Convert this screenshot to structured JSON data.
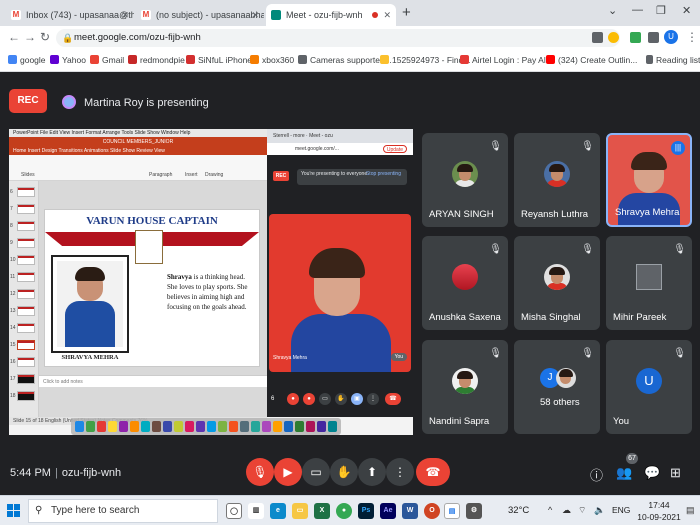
{
  "browser": {
    "tabs": [
      {
        "label": "Inbox (743) - upasanaa@theinde",
        "favicon": "gmail-icon"
      },
      {
        "label": "(no subject) - upasanaabhalla13@",
        "favicon": "gmail-icon"
      },
      {
        "label": "Meet - ozu-fijb-wnh",
        "favicon": "meet-icon"
      }
    ],
    "new_tab": "+",
    "url": "meet.google.com/ozu-fijb-wnh",
    "profile_initial": "U",
    "bookmarks": [
      "google",
      "Yahoo",
      "Gmail",
      "redmondpie",
      "SiNfuL iPhone",
      "xbox360",
      "Cameras supported...",
      "1525924973 - Find...",
      "Airtel Login : Pay Al...",
      "(324) Create Outlin..."
    ],
    "reading_list": "Reading list"
  },
  "meet": {
    "rec_label": "REC",
    "presenting_text": "Martina Roy is presenting",
    "meeting_time": "5:44 PM",
    "meeting_code": "ozu-fijb-wnh",
    "people_count": "67",
    "participants": [
      {
        "name": "ARYAN SINGH",
        "muted": true
      },
      {
        "name": "Reyansh Luthra",
        "muted": true
      },
      {
        "name": "Shravya Mehra",
        "muted": false,
        "speaking": true
      },
      {
        "name": "Anushka Saxena",
        "muted": true
      },
      {
        "name": "Misha Singhal",
        "muted": true
      },
      {
        "name": "Mihir Pareek",
        "muted": true
      },
      {
        "name": "Nandini Sapra",
        "muted": true
      },
      {
        "name": "58 others",
        "muted": true,
        "avatar_initial": "J"
      },
      {
        "name": "You",
        "muted": true,
        "avatar_initial": "U"
      }
    ]
  },
  "shared_screen": {
    "menubar": "PowerPoint  File  Edit  View  Insert  Format  Arrange  Tools  Slide Show  Window  Help",
    "doc_title": "COUNCIL MEMBERS_JUNIOR",
    "ribbon_tabs": "Home  Insert  Design  Transitions  Animations  Slide Show  Review  View",
    "toolbar_labels": [
      "Slides",
      "Paragraph",
      "Insert",
      "Drawing"
    ],
    "thumb_numbers": [
      "6",
      "7",
      "8",
      "9",
      "10",
      "11",
      "12",
      "13",
      "14",
      "15",
      "16",
      "17",
      "18"
    ],
    "slide": {
      "title_first": "VARUN",
      "title_rest": " HOUSE CAPTAIN",
      "crest_label": "",
      "photo_caption": "SHRAVYA MEHRA",
      "bio_name": "Shravya",
      "bio_text": " is a thinking head. She loves to play sports. She believes in aiming high and focusing on the goals ahead."
    },
    "notes_placeholder": "Click to add notes",
    "status_text": "Slide 15 of 18   English (United States)   Notes   Comments   76%",
    "sub_meet": {
      "tabs_text": "Sterrell - more  ·  Meet - ozu",
      "url": "meet.google.com/...",
      "update_label": "Update",
      "rec_label": "REC",
      "notice": "You're presenting to everyone",
      "stop_label": "Stop presenting",
      "self_name": "Shravya Mehra",
      "you_label": "You",
      "count": "6"
    }
  },
  "taskbar": {
    "search_placeholder": "Type here to search",
    "weather": "32°C",
    "lang": "ENG",
    "time": "17:44",
    "date": "10-09-2021"
  }
}
